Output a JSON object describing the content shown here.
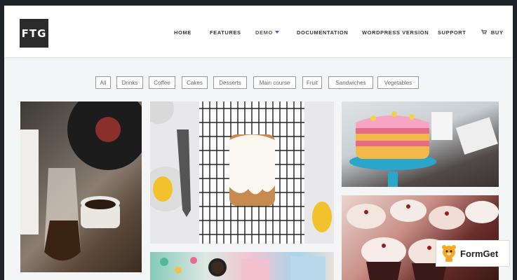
{
  "logo": {
    "text": "FTG"
  },
  "nav": {
    "home": "HOME",
    "features": "FEATURES",
    "demo": "DEMO",
    "documentation": "DOCUMENTATION",
    "wordpress": "WORDPRESS VERSION",
    "support": "SUPPORT",
    "buy": "BUY"
  },
  "filters": [
    "All",
    "Drinks",
    "Coffee",
    "Cakes",
    "Desserts",
    "Main course",
    "Fruit",
    "Sandwiches",
    "Vegetables"
  ],
  "badge": {
    "label": "FormGet"
  },
  "colors": {
    "accent": "#3a6ea5",
    "logo_bg": "#2b2b2b",
    "frame_bg": "#1f2226"
  },
  "icons": [
    "cart-icon",
    "chevron-down-icon",
    "formget-mascot-icon"
  ]
}
